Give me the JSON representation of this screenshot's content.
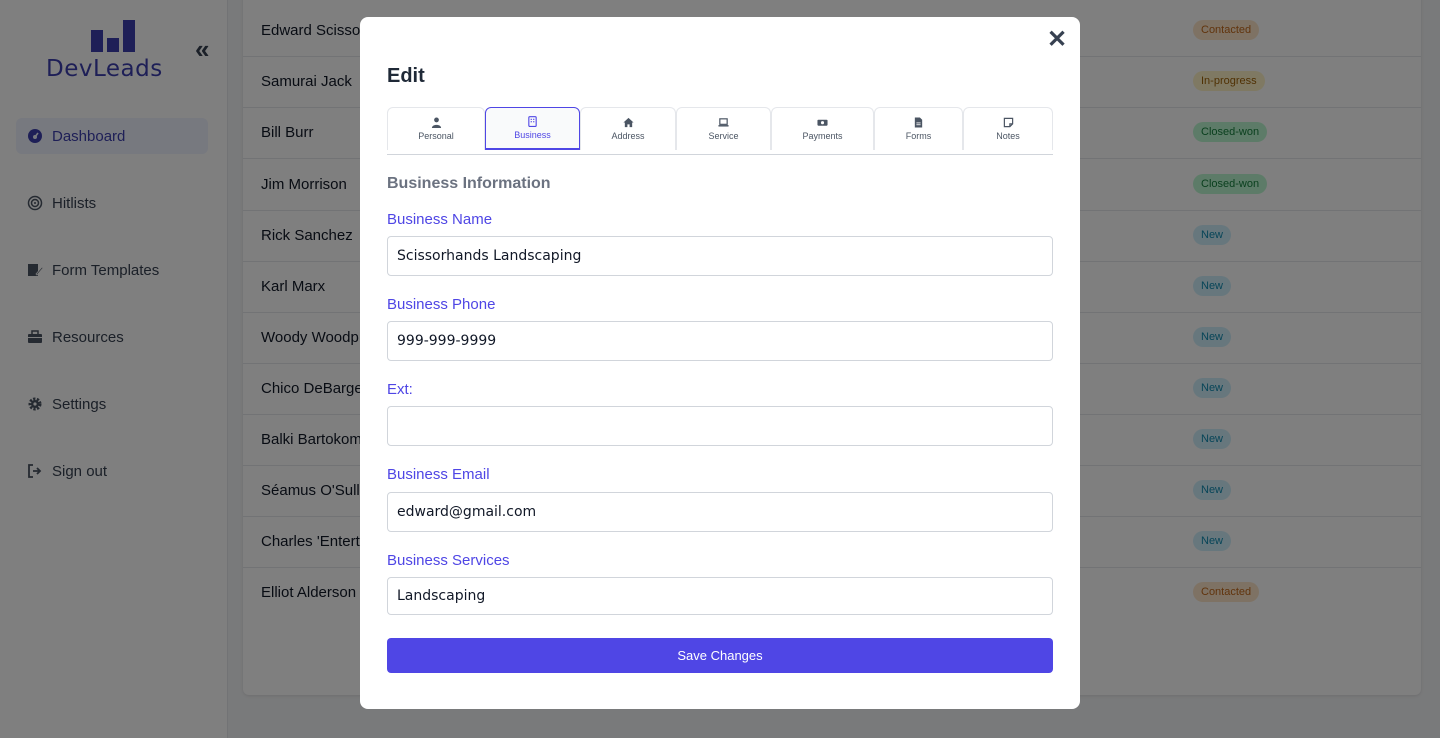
{
  "app": {
    "logo_text": "DevLeads",
    "collapse_icon": "«"
  },
  "sidebar": {
    "items": [
      {
        "label": "Dashboard",
        "icon": "gauge-icon",
        "active": true
      },
      {
        "label": "Hitlists",
        "icon": "target-icon",
        "active": false
      },
      {
        "label": "Form Templates",
        "icon": "pen-file-icon",
        "active": false
      },
      {
        "label": "Resources",
        "icon": "toolbox-icon",
        "active": false
      },
      {
        "label": "Settings",
        "icon": "gear-icon",
        "active": false
      },
      {
        "label": "Sign out",
        "icon": "sign-out-icon",
        "active": false
      }
    ]
  },
  "leads": {
    "rows": [
      {
        "name": "Edward Scissor",
        "status": "Contacted"
      },
      {
        "name": "Samurai Jack",
        "status": "In-progress"
      },
      {
        "name": "Bill Burr",
        "status": "Closed-won"
      },
      {
        "name": "Jim Morrison",
        "status": "Closed-won"
      },
      {
        "name": "Rick Sanchez",
        "status": "New"
      },
      {
        "name": "Karl Marx",
        "status": "New"
      },
      {
        "name": "Woody Woodp",
        "status": "New"
      },
      {
        "name": "Chico DeBarge",
        "status": "New"
      },
      {
        "name": "Balki Bartokom",
        "status": "New"
      },
      {
        "name": "Séamus O'Sulli",
        "status": "New"
      },
      {
        "name": "Charles 'Enterta",
        "status": "New"
      },
      {
        "name": "Elliot Alderson",
        "status": "Contacted"
      }
    ]
  },
  "modal": {
    "close_label": "✕",
    "title": "Edit",
    "tabs": [
      {
        "label": "Personal",
        "icon": "user-icon",
        "active": false
      },
      {
        "label": "Business",
        "icon": "building-icon",
        "active": true
      },
      {
        "label": "Address",
        "icon": "home-icon",
        "active": false
      },
      {
        "label": "Service",
        "icon": "laptop-icon",
        "active": false
      },
      {
        "label": "Payments",
        "icon": "money-icon",
        "active": false
      },
      {
        "label": "Forms",
        "icon": "file-icon",
        "active": false
      },
      {
        "label": "Notes",
        "icon": "note-icon",
        "active": false
      }
    ],
    "section_title": "Business Information",
    "fields": {
      "business_name": {
        "label": "Business Name",
        "value": "Scissorhands Landscaping"
      },
      "business_phone": {
        "label": "Business Phone",
        "value": "999-999-9999"
      },
      "ext": {
        "label": "Ext:",
        "value": ""
      },
      "business_email": {
        "label": "Business Email",
        "value": "edward@gmail.com"
      },
      "business_services": {
        "label": "Business Services",
        "value": "Landscaping"
      }
    },
    "save_label": "Save Changes"
  },
  "colors": {
    "accent": "#4f46e5",
    "brand": "#3d3fae"
  }
}
